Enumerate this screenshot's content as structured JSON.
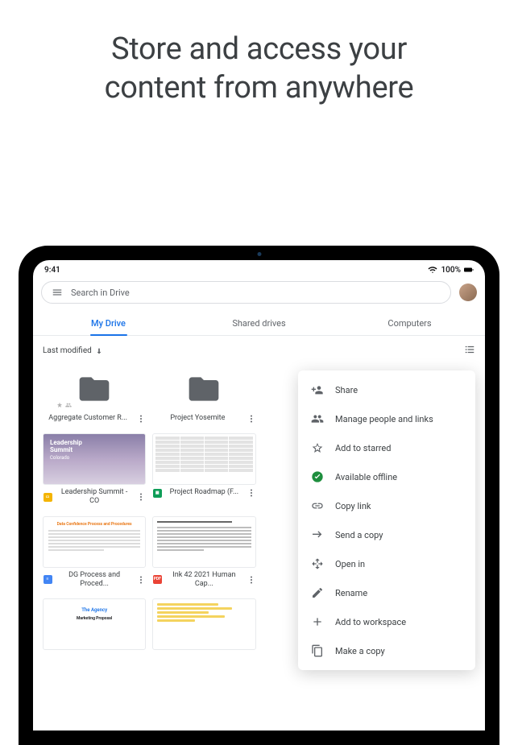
{
  "headline": {
    "line1": "Store and access your",
    "line2": "content from anywhere"
  },
  "statusbar": {
    "time": "9:41",
    "battery": "100%"
  },
  "search": {
    "placeholder": "Search in Drive"
  },
  "tabs": [
    {
      "label": "My Drive",
      "active": true
    },
    {
      "label": "Shared drives",
      "active": false
    },
    {
      "label": "Computers",
      "active": false
    }
  ],
  "sort": {
    "label": "Last modified"
  },
  "folders": [
    {
      "name": "Aggregate Customer R...",
      "starred": true,
      "shared": true
    },
    {
      "name": "Project Yosemite"
    },
    {
      "name": ""
    },
    {
      "name": ""
    }
  ],
  "slides_thumb": {
    "t1": "Leadership",
    "t2": "Summit",
    "t3": "Colorado"
  },
  "files_row1": [
    {
      "name": "Leadership Summit - CO",
      "type": "slides"
    },
    {
      "name": "Project Roadmap (F...",
      "type": "sheets"
    }
  ],
  "doc_thumb_title": "Data Confidence Process and Procedures",
  "files_row2": [
    {
      "name": "DG Process and Proced...",
      "type": "docs"
    },
    {
      "name": "Ink 42 2021 Human Cap...",
      "type": "pdf"
    }
  ],
  "prop_thumb": {
    "p1": "The Agency",
    "p2": "Marketing Proposal"
  },
  "contextMenu": [
    {
      "label": "Share",
      "icon": "person-add"
    },
    {
      "label": "Manage people and links",
      "icon": "people"
    },
    {
      "label": "Add to starred",
      "icon": "star"
    },
    {
      "label": "Available offline",
      "icon": "check-circle",
      "offline": true
    },
    {
      "label": "Copy link",
      "icon": "link"
    },
    {
      "label": "Send a copy",
      "icon": "send"
    },
    {
      "label": "Open in",
      "icon": "open-in"
    },
    {
      "label": "Rename",
      "icon": "pencil"
    },
    {
      "label": "Add to workspace",
      "icon": "plus"
    },
    {
      "label": "Make a copy",
      "icon": "copy"
    }
  ]
}
